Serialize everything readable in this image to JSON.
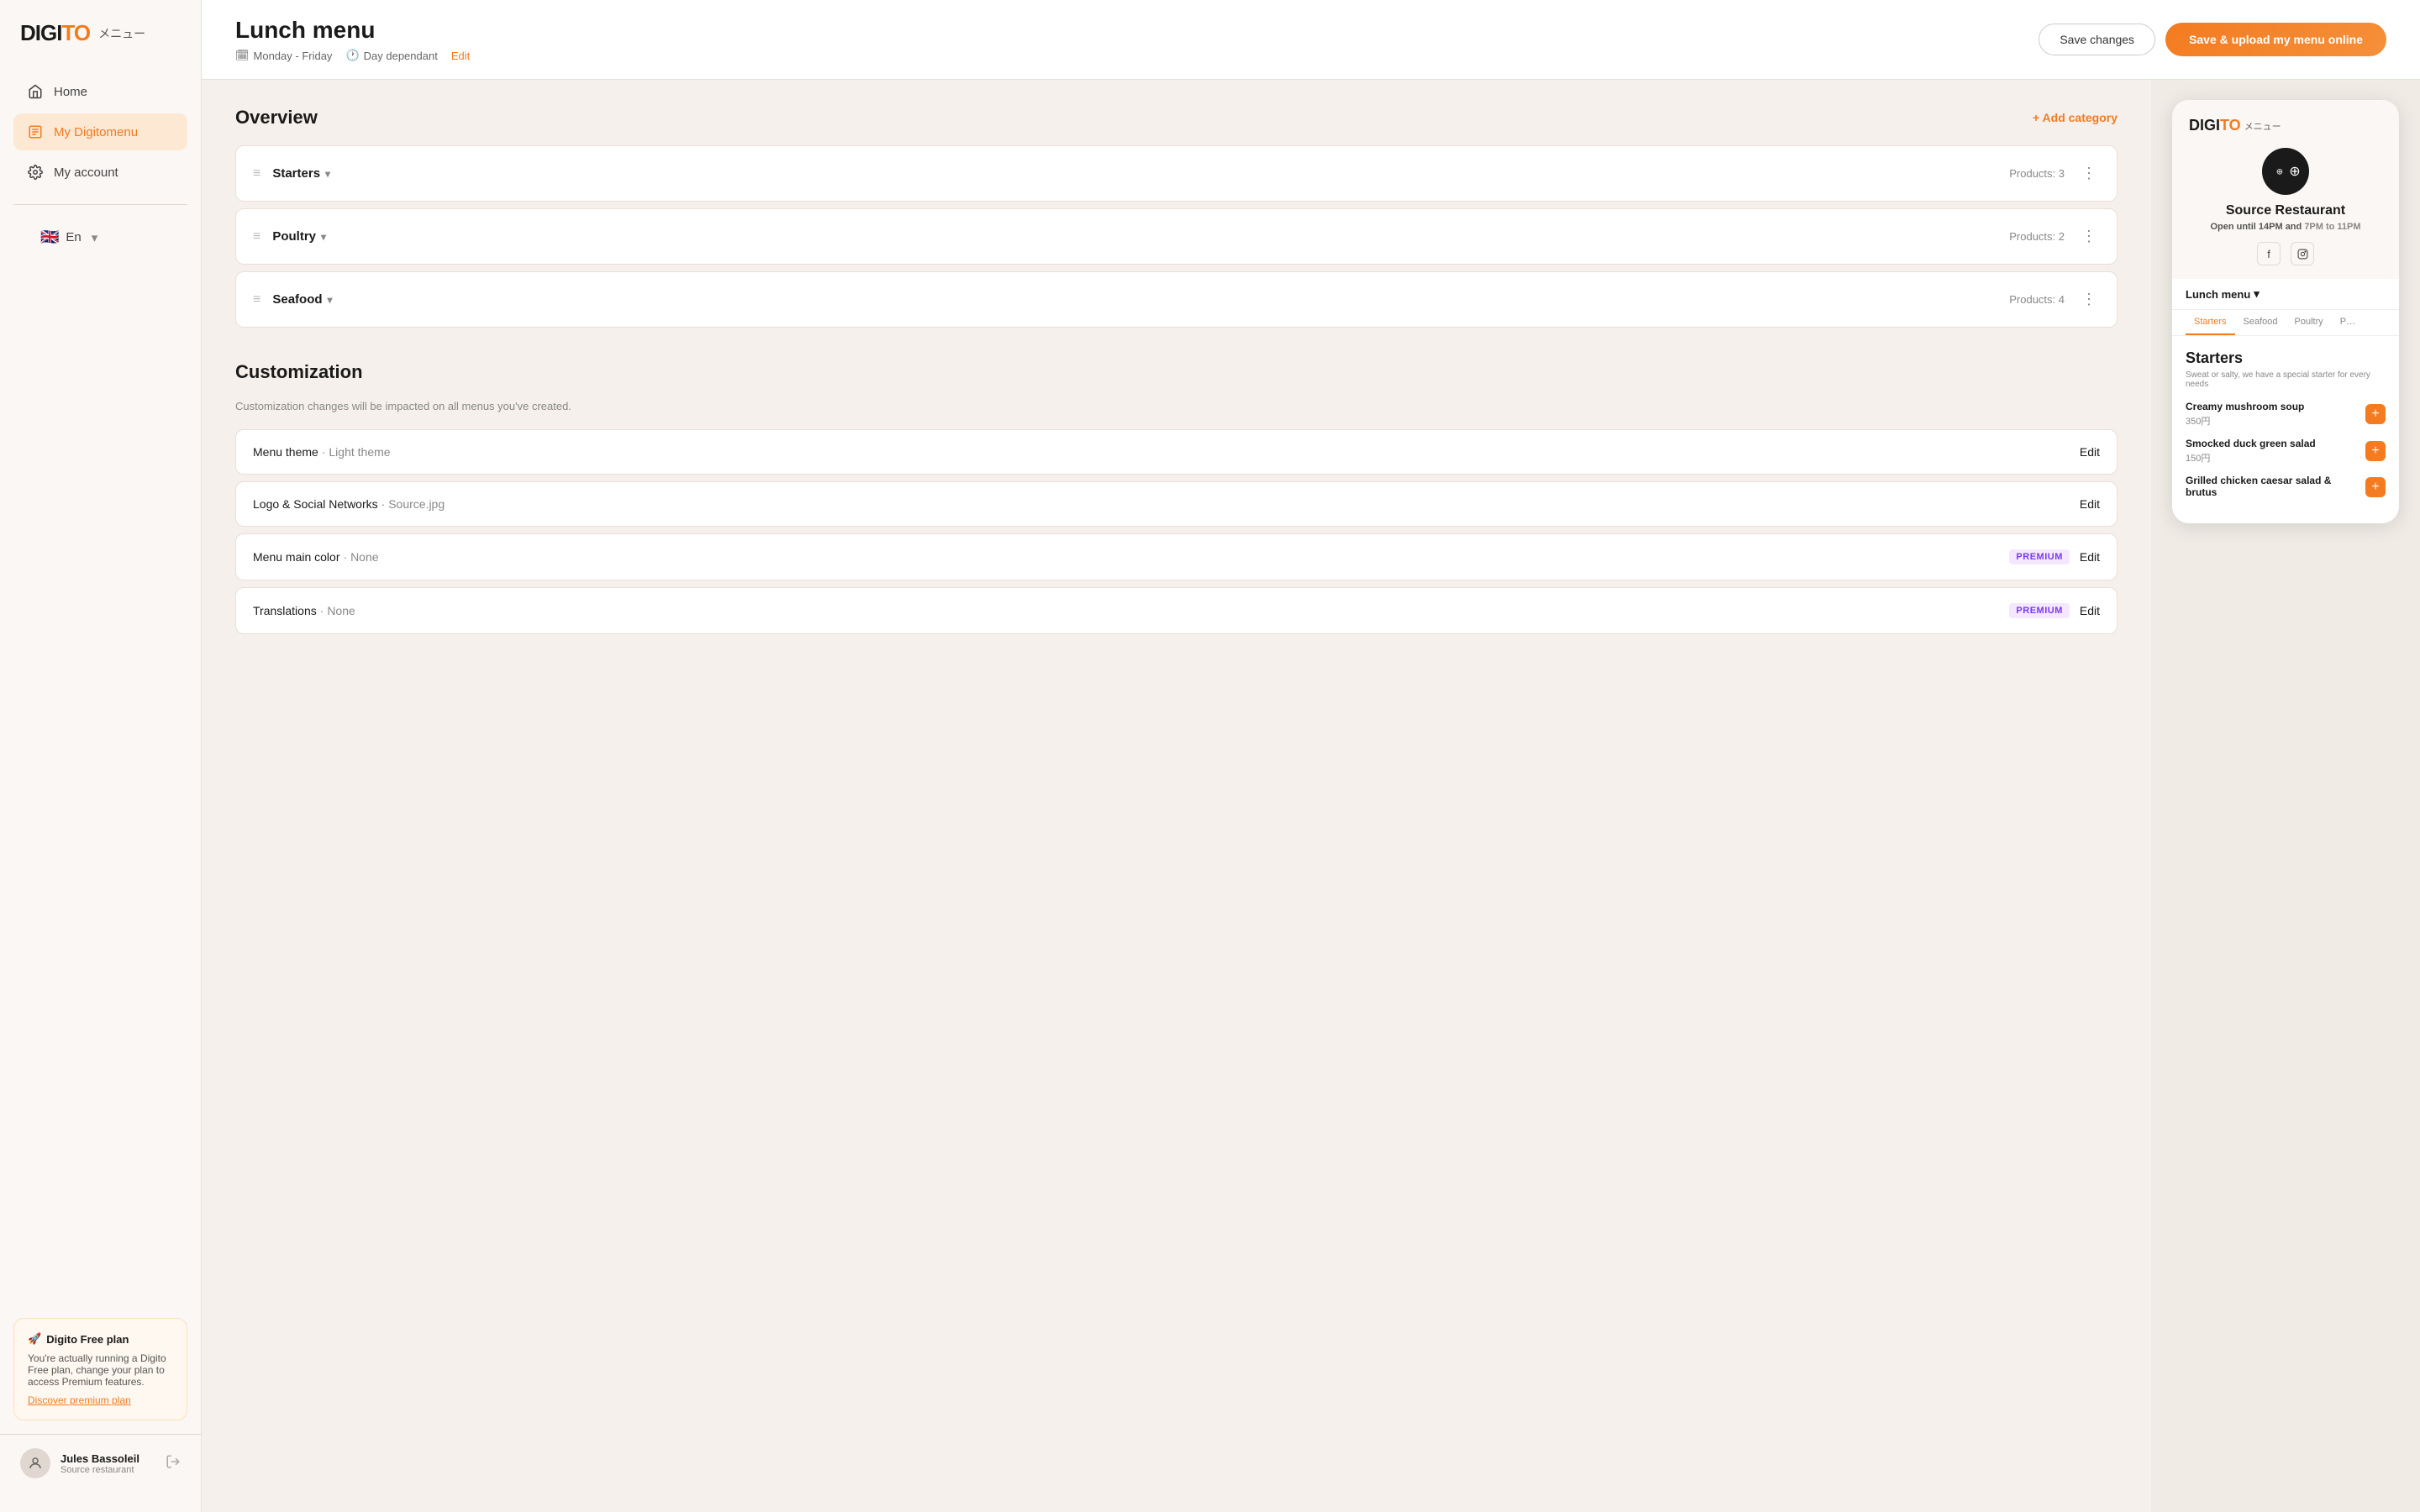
{
  "logo": {
    "digito": "DIGITO",
    "digito_colored": "TO",
    "jp": "メニュー"
  },
  "sidebar": {
    "nav_items": [
      {
        "id": "home",
        "label": "Home",
        "icon": "home-icon",
        "active": false
      },
      {
        "id": "digitomenu",
        "label": "My Digitomenu",
        "icon": "menu-icon",
        "active": true
      },
      {
        "id": "account",
        "label": "My account",
        "icon": "settings-icon",
        "active": false
      }
    ],
    "language": {
      "code": "En",
      "flag": "🇬🇧"
    },
    "free_plan": {
      "emoji": "🚀",
      "title": "Digito Free plan",
      "description": "You're actually running a Digito Free plan, change your plan to access Premium features.",
      "link": "Discover premium plan"
    },
    "user": {
      "name": "Jules Bassoleil",
      "restaurant": "Source restaurant"
    }
  },
  "header": {
    "title": "Lunch menu",
    "meta": {
      "schedule": "Monday - Friday",
      "pricing": "Day dependant",
      "edit_label": "Edit"
    },
    "buttons": {
      "save_changes": "Save changes",
      "upload": "Save & upload my menu online"
    }
  },
  "overview": {
    "title": "Overview",
    "add_category_label": "+ Add category",
    "categories": [
      {
        "id": "starters",
        "name": "Starters",
        "products": "Products: 3"
      },
      {
        "id": "poultry",
        "name": "Poultry",
        "products": "Products: 2"
      },
      {
        "id": "seafood",
        "name": "Seafood",
        "products": "Products: 4"
      }
    ]
  },
  "customization": {
    "title": "Customization",
    "description": "Customization changes will be impacted on all menus you've created.",
    "items": [
      {
        "id": "menu-theme",
        "label": "Menu theme",
        "value": "Light theme",
        "edit": "Edit",
        "premium": false
      },
      {
        "id": "logo-social",
        "label": "Logo & Social Networks",
        "value": "Source.jpg",
        "edit": "Edit",
        "premium": false
      },
      {
        "id": "menu-color",
        "label": "Menu main color",
        "value": "None",
        "edit": "Edit",
        "premium": true
      },
      {
        "id": "translations",
        "label": "Translations",
        "value": "None",
        "edit": "Edit",
        "premium": true
      }
    ],
    "premium_label": "PREMIUM"
  },
  "preview": {
    "logo": {
      "text": "DIGITO",
      "jp": "メニュー"
    },
    "restaurant": {
      "name": "Source Restaurant",
      "hours_line1": "Open until 14PM",
      "and": "and",
      "hours_line2": "7PM to 11PM"
    },
    "menu_selector": "Lunch menu",
    "tabs": [
      "Starters",
      "Seafood",
      "Poultry",
      "P"
    ],
    "category_title": "Starters",
    "category_desc": "Sweat or salty, we have a special starter for every needs",
    "products": [
      {
        "name": "Creamy mushroom soup",
        "price": "350円"
      },
      {
        "name": "Smocked duck green salad",
        "price": "150円"
      },
      {
        "name": "Grilled chicken caesar salad & brutus",
        "price": ""
      }
    ]
  }
}
